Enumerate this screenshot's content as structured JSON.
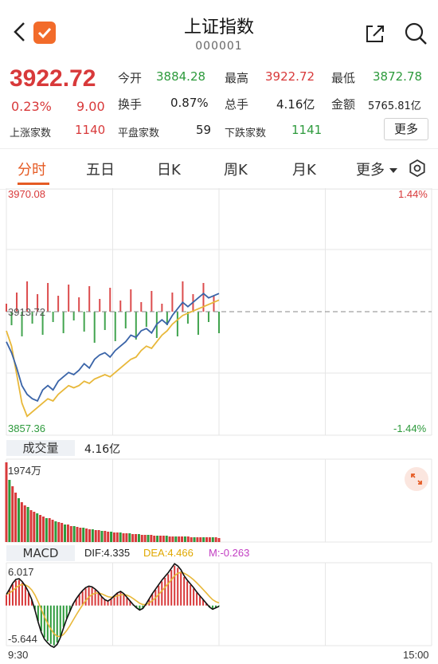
{
  "header": {
    "title": "上证指数",
    "code": "000001"
  },
  "quote": {
    "price": "3922.72",
    "change_pct": "0.23%",
    "change_val": "9.00",
    "open_label": "今开",
    "open": "3884.28",
    "high_label": "最高",
    "high": "3922.72",
    "low_label": "最低",
    "low": "3872.78",
    "turnover_label": "换手",
    "turnover": "0.87%",
    "volume_label": "总手",
    "volume": "4.16亿",
    "amount_label": "金额",
    "amount": "5765.81亿",
    "up_label": "上涨家数",
    "up": "1140",
    "flat_label": "平盘家数",
    "flat": "59",
    "down_label": "下跌家数",
    "down": "1141",
    "more_label": "更多"
  },
  "tabs": [
    "分时",
    "五日",
    "日K",
    "周K",
    "月K",
    "更多"
  ],
  "active_tab": "分时",
  "price_chart": {
    "top_price": "3970.08",
    "top_pct": "1.44%",
    "mid_price": "3913.72",
    "bottom_price": "3857.36",
    "bottom_pct": "-1.44%"
  },
  "volume_panel": {
    "label": "成交量",
    "total": "4.16亿",
    "max": "1974万"
  },
  "macd_panel": {
    "label": "MACD",
    "dif": "DIF:4.335",
    "dea": "DEA:4.466",
    "m": "M:-0.263",
    "top": "6.017",
    "bottom": "-5.644"
  },
  "time_axis": {
    "start": "9:30",
    "end": "15:00"
  },
  "colors": {
    "up": "#d8393a",
    "down": "#2d9a3c",
    "accent": "#e55b24",
    "price_line": "#3a64a8",
    "avg_line": "#e8b83a"
  },
  "chart_data": [
    {
      "type": "line",
      "series": [
        {
          "values": [
            3900,
            3895,
            3888,
            3880,
            3876,
            3874,
            3873,
            3878,
            3880,
            3878,
            3882,
            3884,
            3886,
            3885,
            3887,
            3890,
            3888,
            3892,
            3894,
            3895,
            3893,
            3896,
            3898,
            3900,
            3903,
            3902,
            3905,
            3906,
            3904,
            3908,
            3910,
            3908,
            3912,
            3915,
            3918,
            3916,
            3918,
            3920,
            3922,
            3920,
            3921,
            3922
          ]
        },
        {
          "values": [
            3905,
            3898,
            3885,
            3872,
            3866,
            3868,
            3870,
            3872,
            3874,
            3873,
            3876,
            3878,
            3880,
            3879,
            3880,
            3882,
            3881,
            3883,
            3884,
            3885,
            3884,
            3886,
            3888,
            3890,
            3892,
            3893,
            3896,
            3898,
            3897,
            3900,
            3903,
            3905,
            3908,
            3910,
            3912,
            3913,
            3914,
            3915,
            3916,
            3917,
            3918,
            3919
          ]
        }
      ],
      "ylim": [
        3857.36,
        3970.08
      ]
    },
    {
      "type": "bar",
      "values": [
        100,
        78,
        70,
        62,
        55,
        50,
        46,
        44,
        40,
        38,
        36,
        34,
        32,
        30,
        30,
        28,
        26,
        25,
        24,
        22,
        22,
        20,
        20,
        19,
        18,
        18,
        17,
        16,
        16,
        15,
        15,
        14,
        14,
        13,
        13,
        12,
        12,
        12,
        11,
        11,
        11,
        10,
        10,
        10,
        9,
        9,
        9,
        9,
        8,
        8,
        8,
        8,
        8,
        7,
        7,
        7,
        7,
        7,
        7,
        7,
        6,
        6,
        6,
        6,
        6,
        6,
        6,
        6,
        6,
        5
      ],
      "ylim": [
        0,
        1974
      ]
    },
    {
      "type": "bar",
      "values": [
        1.5,
        2.2,
        3.0,
        3.5,
        3.6,
        3.2,
        2.6,
        1.8,
        0.8,
        -0.6,
        -2.2,
        -3.6,
        -4.5,
        -5.0,
        -5.4,
        -5.6,
        -5.2,
        -4.3,
        -3.0,
        -1.8,
        -0.8,
        0.2,
        0.9,
        1.5,
        2.0,
        2.4,
        2.6,
        2.5,
        2.2,
        1.8,
        1.2,
        0.8,
        0.6,
        0.9,
        1.3,
        1.7,
        1.9,
        1.6,
        1.1,
        0.6,
        0.1,
        -0.3,
        -0.6,
        -0.4,
        0.2,
        0.9,
        1.6,
        2.2,
        2.8,
        3.4,
        3.9,
        4.4,
        5.0,
        5.6,
        5.3,
        4.8,
        4.0,
        3.4,
        2.9,
        2.4,
        1.8,
        1.3,
        0.8,
        0.3,
        -0.2,
        -0.5,
        -0.3,
        -0.1
      ],
      "ylim": [
        -5.644,
        6.017
      ]
    }
  ]
}
